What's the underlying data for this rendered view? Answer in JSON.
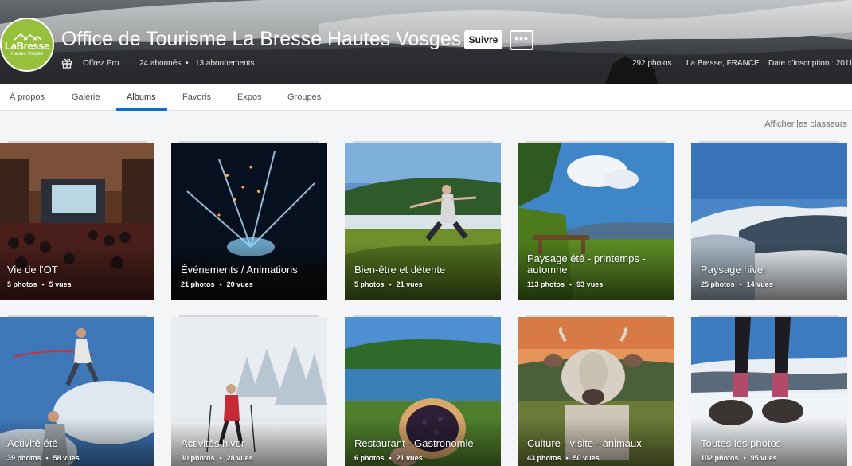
{
  "profile": {
    "name": "Office de Tourisme La Bresse Hautes Vosges",
    "logo_text": "LaBresse",
    "logo_subtext": "Hautes Vosges",
    "follow_label": "Suivre",
    "more_label": "•••",
    "offer_label": "Offrez Pro",
    "followers": "24 abonnés",
    "following": "13 abonnements",
    "photos_count": "292 photos",
    "location": "La Bresse, FRANCE",
    "joined": "Date d'inscription : 2011"
  },
  "tabs": [
    {
      "label": "À propos",
      "active": false
    },
    {
      "label": "Galerie",
      "active": false
    },
    {
      "label": "Albums",
      "active": true
    },
    {
      "label": "Favoris",
      "active": false
    },
    {
      "label": "Expos",
      "active": false
    },
    {
      "label": "Groupes",
      "active": false
    }
  ],
  "show_sets_label": "Afficher les classeurs",
  "albums": [
    {
      "title": "Vie de l'OT",
      "photos": "5 photos",
      "views": "5 vues"
    },
    {
      "title": "Événements / Animations",
      "photos": "21 photos",
      "views": "20 vues"
    },
    {
      "title": "Bien-être et détente",
      "photos": "5 photos",
      "views": "21 vues"
    },
    {
      "title": "Paysage été - printemps - automne",
      "photos": "113 photos",
      "views": "93 vues"
    },
    {
      "title": "Paysage hiver",
      "photos": "25 photos",
      "views": "14 vues"
    },
    {
      "title": "Activité été",
      "photos": "39 photos",
      "views": "58 vues"
    },
    {
      "title": "Activités hiver",
      "photos": "30 photos",
      "views": "28 vues"
    },
    {
      "title": "Restaurant - Gastronomie",
      "photos": "6 photos",
      "views": "21 vues"
    },
    {
      "title": "Culture - visite - animaux",
      "photos": "43 photos",
      "views": "50 vues"
    },
    {
      "title": "Toutes les photos",
      "photos": "102 photos",
      "views": "95 vues"
    }
  ],
  "colors": {
    "accent": "#0870d1",
    "logo_green": "#97c13d"
  },
  "icons": {
    "gift": "gift-icon",
    "more": "more-icon"
  }
}
